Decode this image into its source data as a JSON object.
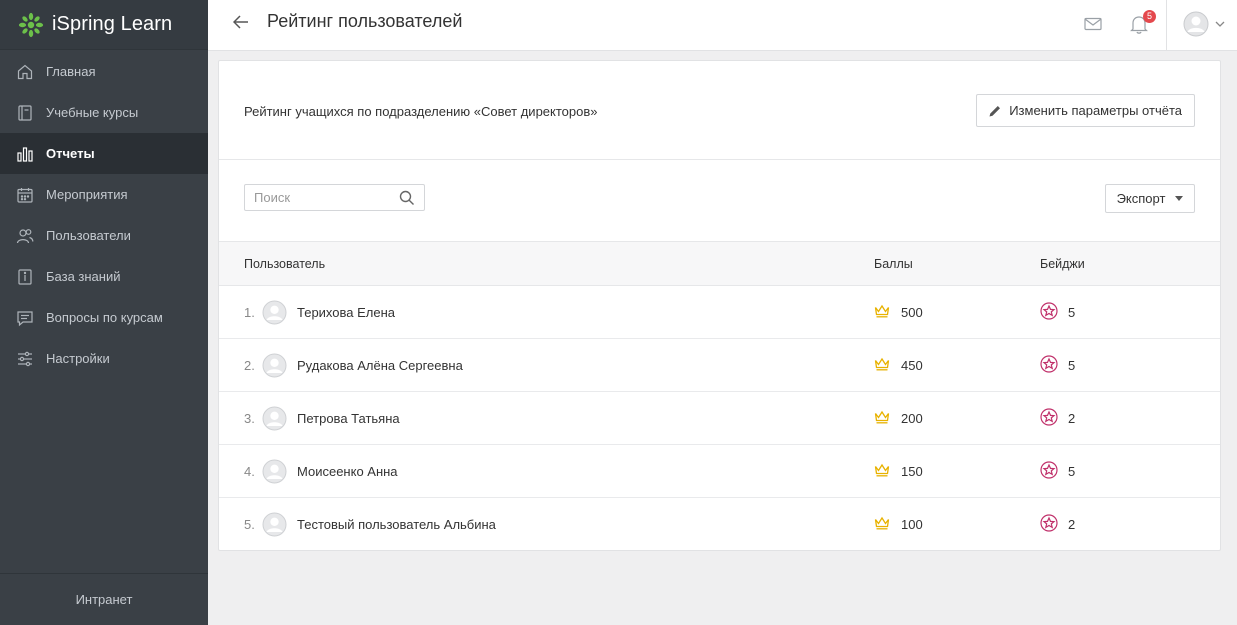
{
  "app": {
    "brand": "iSpring Learn"
  },
  "sidebar": {
    "items": [
      {
        "label": "Главная",
        "icon": "home-icon",
        "active": false
      },
      {
        "label": "Учебные курсы",
        "icon": "book-icon",
        "active": false
      },
      {
        "label": "Отчеты",
        "icon": "bar-chart-icon",
        "active": true
      },
      {
        "label": "Мероприятия",
        "icon": "calendar-icon",
        "active": false
      },
      {
        "label": "Пользователи",
        "icon": "users-icon",
        "active": false
      },
      {
        "label": "База знаний",
        "icon": "knowledge-base-icon",
        "active": false
      },
      {
        "label": "Вопросы по курсам",
        "icon": "chat-icon",
        "active": false
      },
      {
        "label": "Настройки",
        "icon": "sliders-icon",
        "active": false
      }
    ],
    "footer": "Интранет"
  },
  "header": {
    "title": "Рейтинг пользователей",
    "notifications_count": "5"
  },
  "report": {
    "description": "Рейтинг учащихся по подразделению «Совет директоров»",
    "edit_label": "Изменить параметры отчёта"
  },
  "toolbar": {
    "search_placeholder": "Поиск",
    "export_label": "Экспорт"
  },
  "table": {
    "columns": {
      "user": "Пользователь",
      "score": "Баллы",
      "badges": "Бейджи"
    },
    "rows": [
      {
        "rank": "1.",
        "name": "Терихова Елена",
        "score": "500",
        "badges": "5"
      },
      {
        "rank": "2.",
        "name": "Рудакова Алёна Сергеевна",
        "score": "450",
        "badges": "5"
      },
      {
        "rank": "3.",
        "name": "Петрова Татьяна",
        "score": "200",
        "badges": "2"
      },
      {
        "rank": "4.",
        "name": "Моисеенко Анна",
        "score": "150",
        "badges": "5"
      },
      {
        "rank": "5.",
        "name": "Тестовый пользователь Альбина",
        "score": "100",
        "badges": "2"
      }
    ]
  },
  "colors": {
    "sidebar_bg": "#3a4046",
    "sidebar_active": "#2a2f34",
    "brand_green": "#5cb85c",
    "crown": "#e8b200",
    "badge": "#c0306a",
    "notification": "#e4484d"
  }
}
